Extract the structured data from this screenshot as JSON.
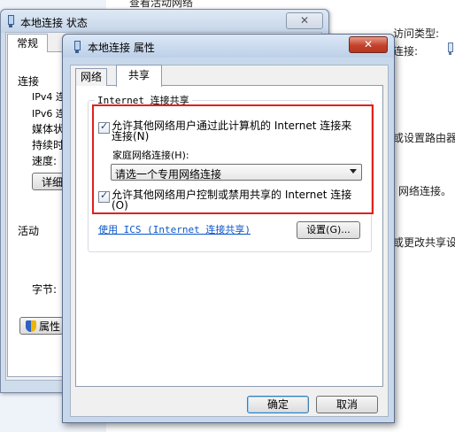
{
  "background": {
    "top_text": "查看活动网络",
    "right_labels": [
      {
        "id": "access-type",
        "text": "访问类型:"
      },
      {
        "id": "connection",
        "text": "连接:"
      },
      {
        "id": "router-setup",
        "text": "或设置路由器"
      },
      {
        "id": "network-connection",
        "text": "网络连接。"
      },
      {
        "id": "change-sharing",
        "text": "或更改共享设"
      }
    ]
  },
  "status_window": {
    "title": "本地连接 状态",
    "close_symbol": "✕",
    "tab": "常规",
    "labels": {
      "connection": "连接",
      "ipv4": "IPv4 连",
      "ipv6": "IPv6 连",
      "media": "媒体状",
      "duration": "持续时",
      "speed": "速度:",
      "activity": "活动",
      "bytes": "字节:"
    },
    "details_button": "详细",
    "properties_button": "属性"
  },
  "properties_dialog": {
    "title": "本地连接 属性",
    "close_symbol": "✕",
    "tabs": [
      "网络",
      "共享"
    ],
    "group_title": "Internet 连接共享",
    "allow_share_checked": true,
    "allow_share_label": "允许其他网络用户通过此计算机的 Internet 连接来连接(N)",
    "home_network_label": "家庭网络连接(H):",
    "home_network_value": "请选一个专用网络连接",
    "allow_control_checked": true,
    "allow_control_label": "允许其他网络用户控制或禁用共享的 Internet 连接(O)",
    "ics_link": "使用 ICS (Internet 连接共享)",
    "settings_button": "设置(G)...",
    "ok_button": "确定",
    "cancel_button": "取消"
  },
  "colors": {
    "highlight_border": "#e0201f",
    "link": "#0b56c8",
    "close_button": "#c4422b"
  }
}
